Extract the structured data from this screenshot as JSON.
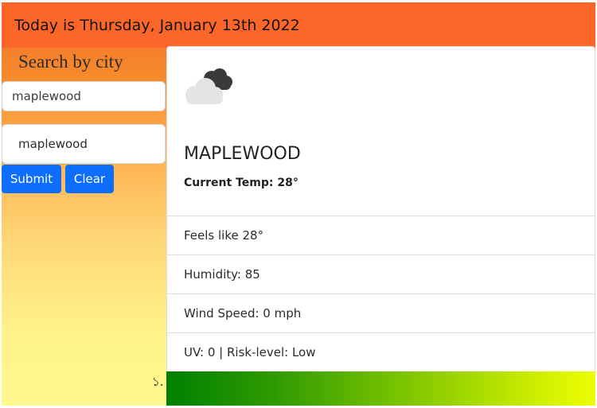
{
  "header": {
    "date_text": "Today is Thursday, January 13th 2022"
  },
  "sidebar": {
    "title": "Search by city",
    "search_input_value": "maplewood",
    "history": [
      "maplewood"
    ],
    "submit_label": "Submit",
    "clear_label": "Clear"
  },
  "weather": {
    "icon": "cloudy-icon",
    "city": "MAPLEWOOD",
    "current_temp": "Current Temp: 28°",
    "feels_like": "Feels like 28°",
    "humidity": "Humidity: 85",
    "wind_speed": "Wind Speed: 0 mph",
    "uv": "UV: 0 | Risk-level: Low"
  },
  "uv_scale": {
    "start_color": "#008000",
    "end_color": "#eeff00"
  },
  "stray_text": "১.",
  "colors": {
    "header": "#fd6629",
    "button": "#0d6efd"
  }
}
